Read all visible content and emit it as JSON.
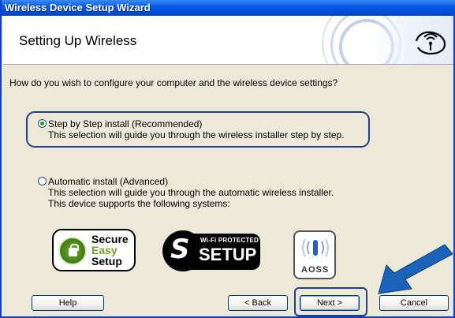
{
  "window": {
    "title": "Wireless Device Setup Wizard"
  },
  "banner": {
    "heading": "Setting Up Wireless"
  },
  "question": "How do you wish to configure your computer and the wireless device settings?",
  "options": [
    {
      "label": "Step by Step install (Recommended)",
      "lines": [
        "This selection will guide you through the wireless installer step by step."
      ],
      "selected": true
    },
    {
      "label": "Automatic install (Advanced)",
      "lines": [
        "This selection will guide you through the automatic wireless installer.",
        "This device supports the following systems:"
      ],
      "selected": false
    }
  ],
  "logos": {
    "ses": [
      "Secure",
      "Easy",
      "Setup"
    ],
    "wps_small": "Wi-Fi PROTECTED",
    "wps_big": "SETUP",
    "aoss": "AOSS"
  },
  "buttons": {
    "help": "Help",
    "back": "< Back",
    "next": "Next >",
    "cancel": "Cancel"
  },
  "colors": {
    "titlebar": "#0a5ce6",
    "highlight": "#1f3f8c",
    "arrow": "#1b63b8"
  }
}
